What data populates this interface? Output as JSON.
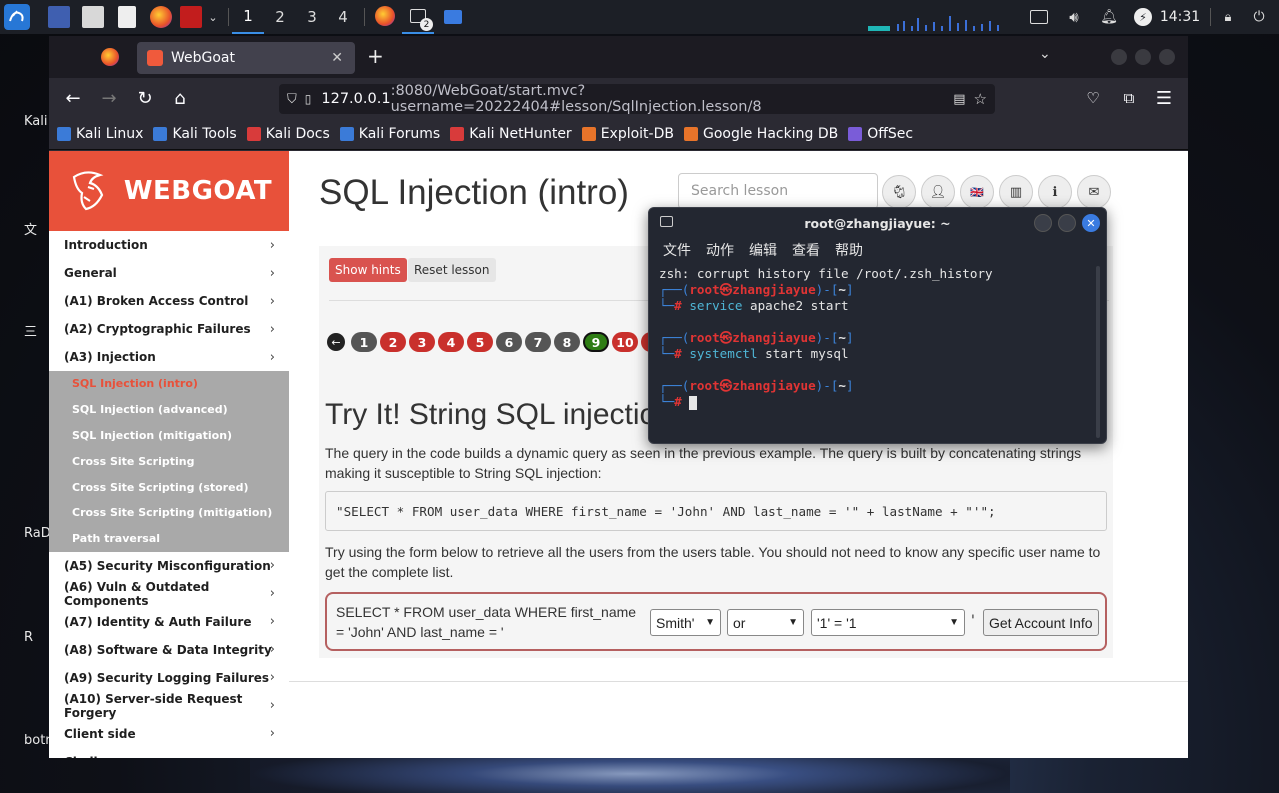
{
  "desktop": {
    "icons": [
      "Kali",
      "文",
      "三",
      "RaD",
      "R",
      "botr"
    ]
  },
  "panel": {
    "workspaces": [
      "1",
      "2",
      "3",
      "4"
    ],
    "terminal_badge": "2",
    "clock": "14:31"
  },
  "browser": {
    "tab_title": "WebGoat",
    "url_host": "127.0.0.1",
    "url_rest": ":8080/WebGoat/start.mvc?username=20222404#lesson/SqlInjection.lesson/8",
    "bookmarks": [
      {
        "label": "Kali Linux",
        "color": "#3b7bd8"
      },
      {
        "label": "Kali Tools",
        "color": "#3b7bd8"
      },
      {
        "label": "Kali Docs",
        "color": "#d83b3b"
      },
      {
        "label": "Kali Forums",
        "color": "#3b7bd8"
      },
      {
        "label": "Kali NetHunter",
        "color": "#d83b3b"
      },
      {
        "label": "Exploit-DB",
        "color": "#e8742a"
      },
      {
        "label": "Google Hacking DB",
        "color": "#e8742a"
      },
      {
        "label": "OffSec",
        "color": "#7a5cd8"
      }
    ]
  },
  "webgoat": {
    "logo_text": "WEBGOAT",
    "page_title": "SQL Injection (intro)",
    "search_placeholder": "Search lesson",
    "menu": [
      {
        "label": "Introduction"
      },
      {
        "label": "General"
      },
      {
        "label": "(A1) Broken Access Control"
      },
      {
        "label": "(A2) Cryptographic Failures"
      },
      {
        "label": "(A3) Injection"
      }
    ],
    "submenu": [
      {
        "label": "SQL Injection (intro)",
        "current": true
      },
      {
        "label": "SQL Injection (advanced)"
      },
      {
        "label": "SQL Injection (mitigation)"
      },
      {
        "label": "Cross Site Scripting"
      },
      {
        "label": "Cross Site Scripting (stored)"
      },
      {
        "label": "Cross Site Scripting (mitigation)"
      },
      {
        "label": "Path traversal"
      }
    ],
    "menu2": [
      {
        "label": "(A5) Security Misconfiguration"
      },
      {
        "label": "(A6) Vuln & Outdated Components"
      },
      {
        "label": "(A7) Identity & Auth Failure"
      },
      {
        "label": "(A8) Software & Data Integrity"
      },
      {
        "label": "(A9) Security Logging Failures"
      },
      {
        "label": "(A10) Server-side Request Forgery"
      },
      {
        "label": "Client side"
      },
      {
        "label": "Challenges"
      }
    ],
    "buttons": {
      "show_hints": "Show hints",
      "reset_lesson": "Reset lesson"
    },
    "pages": [
      {
        "n": "1",
        "color": "#555"
      },
      {
        "n": "2",
        "color": "#c9302c"
      },
      {
        "n": "3",
        "color": "#c9302c"
      },
      {
        "n": "4",
        "color": "#c9302c"
      },
      {
        "n": "5",
        "color": "#c9302c"
      },
      {
        "n": "6",
        "color": "#555"
      },
      {
        "n": "7",
        "color": "#555"
      },
      {
        "n": "8",
        "color": "#555"
      },
      {
        "n": "9",
        "color": "#2e7d14"
      },
      {
        "n": "10",
        "color": "#c9302c"
      },
      {
        "n": "1",
        "color": "#c9302c"
      }
    ],
    "heading": "Try It! String SQL injection",
    "para1": "The query in the code builds a dynamic query as seen in the previous example. The query is built by concatenating strings making it susceptible to String SQL injection:",
    "code": "\"SELECT * FROM user_data WHERE first_name = 'John' AND last_name = '\" + lastName + \"'\";",
    "para2": "Try using the form below to retrieve all the users from the users table. You should not need to know any specific user name to get the complete list.",
    "form": {
      "query_text": "SELECT * FROM user_data WHERE first_name = 'John' AND last_name = '",
      "sel1": "Smith'",
      "sel2": "or",
      "sel3": "'1' = '1",
      "quote": "'",
      "submit": "Get Account Info"
    }
  },
  "terminal": {
    "title": "root@zhangjiayue: ~",
    "menu": [
      "文件",
      "动作",
      "编辑",
      "查看",
      "帮助"
    ],
    "line0": "zsh: corrupt history file /root/.zsh_history",
    "prompt_user": "root㉿zhangjiayue",
    "prompt_dir": "~",
    "commands": [
      {
        "cmd": "service",
        "args": " apache2 start"
      },
      {
        "cmd": "systemctl",
        "args": " start mysql"
      }
    ]
  }
}
